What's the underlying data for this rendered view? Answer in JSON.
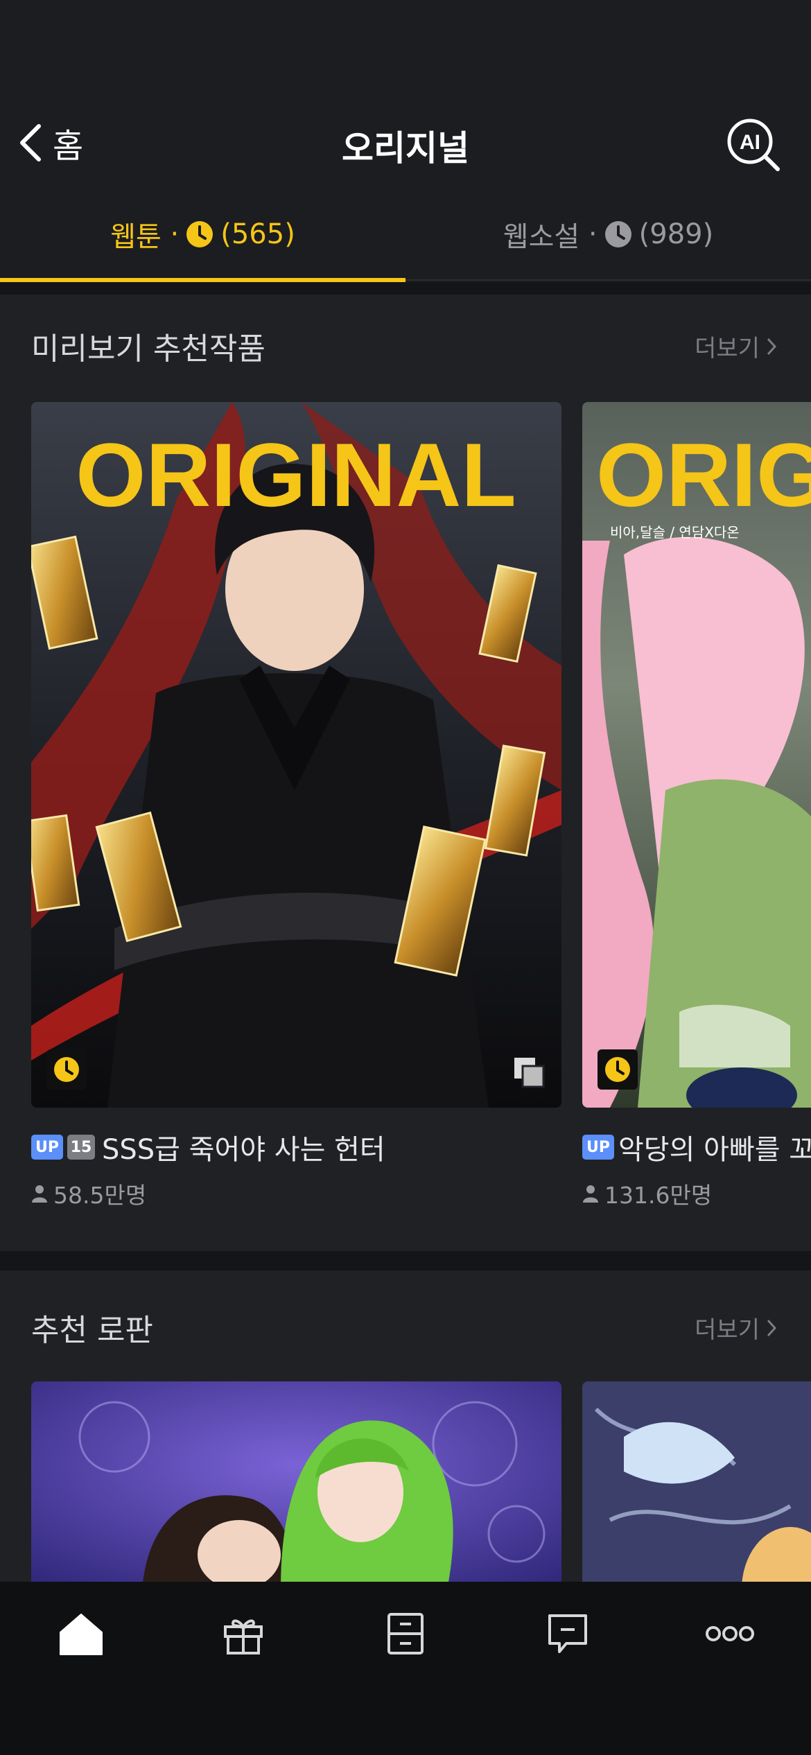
{
  "header": {
    "back_label": "홈",
    "title": "오리지널",
    "ai_label": "AI"
  },
  "tabs": [
    {
      "label": "웹툰",
      "count": "(565)",
      "active": true
    },
    {
      "label": "웹소설",
      "count": "(989)",
      "active": false
    }
  ],
  "sections": [
    {
      "title": "미리보기 추천작품",
      "more_label": "더보기",
      "cards": [
        {
          "title": "SSS급 죽어야 사는 헌터",
          "badge_up": "UP",
          "badge_age": "15",
          "views": "58.5만명",
          "cover_text": "ORIGINAL"
        },
        {
          "title": "악당의 아빠를 꼬",
          "badge_up": "UP",
          "views": "131.6만명",
          "cover_text": "ORIG",
          "cover_credit": "비아,달슬 / 연담X다온"
        }
      ]
    },
    {
      "title": "추천 로판",
      "more_label": "더보기"
    }
  ],
  "bottom_nav": [
    {
      "icon": "home-icon",
      "active": true
    },
    {
      "icon": "gift-icon",
      "active": false
    },
    {
      "icon": "archive-icon",
      "active": false
    },
    {
      "icon": "comment-icon",
      "active": false
    },
    {
      "icon": "more-icon",
      "active": false
    }
  ],
  "colors": {
    "accent": "#f5c518",
    "background": "#1c1d20",
    "section_bg": "#202124",
    "badge_up": "#5b8ff9"
  }
}
